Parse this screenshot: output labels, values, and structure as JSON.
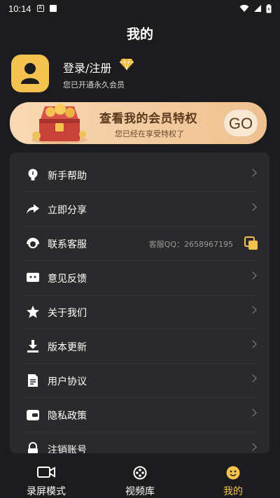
{
  "status_bar": {
    "time": "10:14"
  },
  "page": {
    "title": "我的"
  },
  "profile": {
    "login_label": "登录/注册",
    "subtitle": "您已开通永久会员"
  },
  "banner": {
    "title": "查看我的会员特权",
    "subtitle": "您已经在享受特权了",
    "go_label": "GO"
  },
  "menu": {
    "items": [
      {
        "label": "新手帮助",
        "icon": "bulb-icon"
      },
      {
        "label": "立即分享",
        "icon": "share-icon"
      },
      {
        "label": "联系客服",
        "icon": "headset-icon",
        "extra": "客服QQ：2658967195"
      },
      {
        "label": "意见反馈",
        "icon": "feedback-icon"
      },
      {
        "label": "关于我们",
        "icon": "star-icon"
      },
      {
        "label": "版本更新",
        "icon": "download-icon"
      },
      {
        "label": "用户协议",
        "icon": "document-icon"
      },
      {
        "label": "隐私政策",
        "icon": "wallet-icon"
      },
      {
        "label": "注销账号",
        "icon": "lock-icon"
      }
    ]
  },
  "tabs": [
    {
      "label": "录屏模式",
      "icon": "camera-icon"
    },
    {
      "label": "视频库",
      "icon": "film-reel-icon"
    },
    {
      "label": "我的",
      "icon": "smiley-icon",
      "active": true
    }
  ],
  "colors": {
    "accent": "#f3c24f",
    "background": "#1c1c1e",
    "card": "#2a2a2c"
  }
}
